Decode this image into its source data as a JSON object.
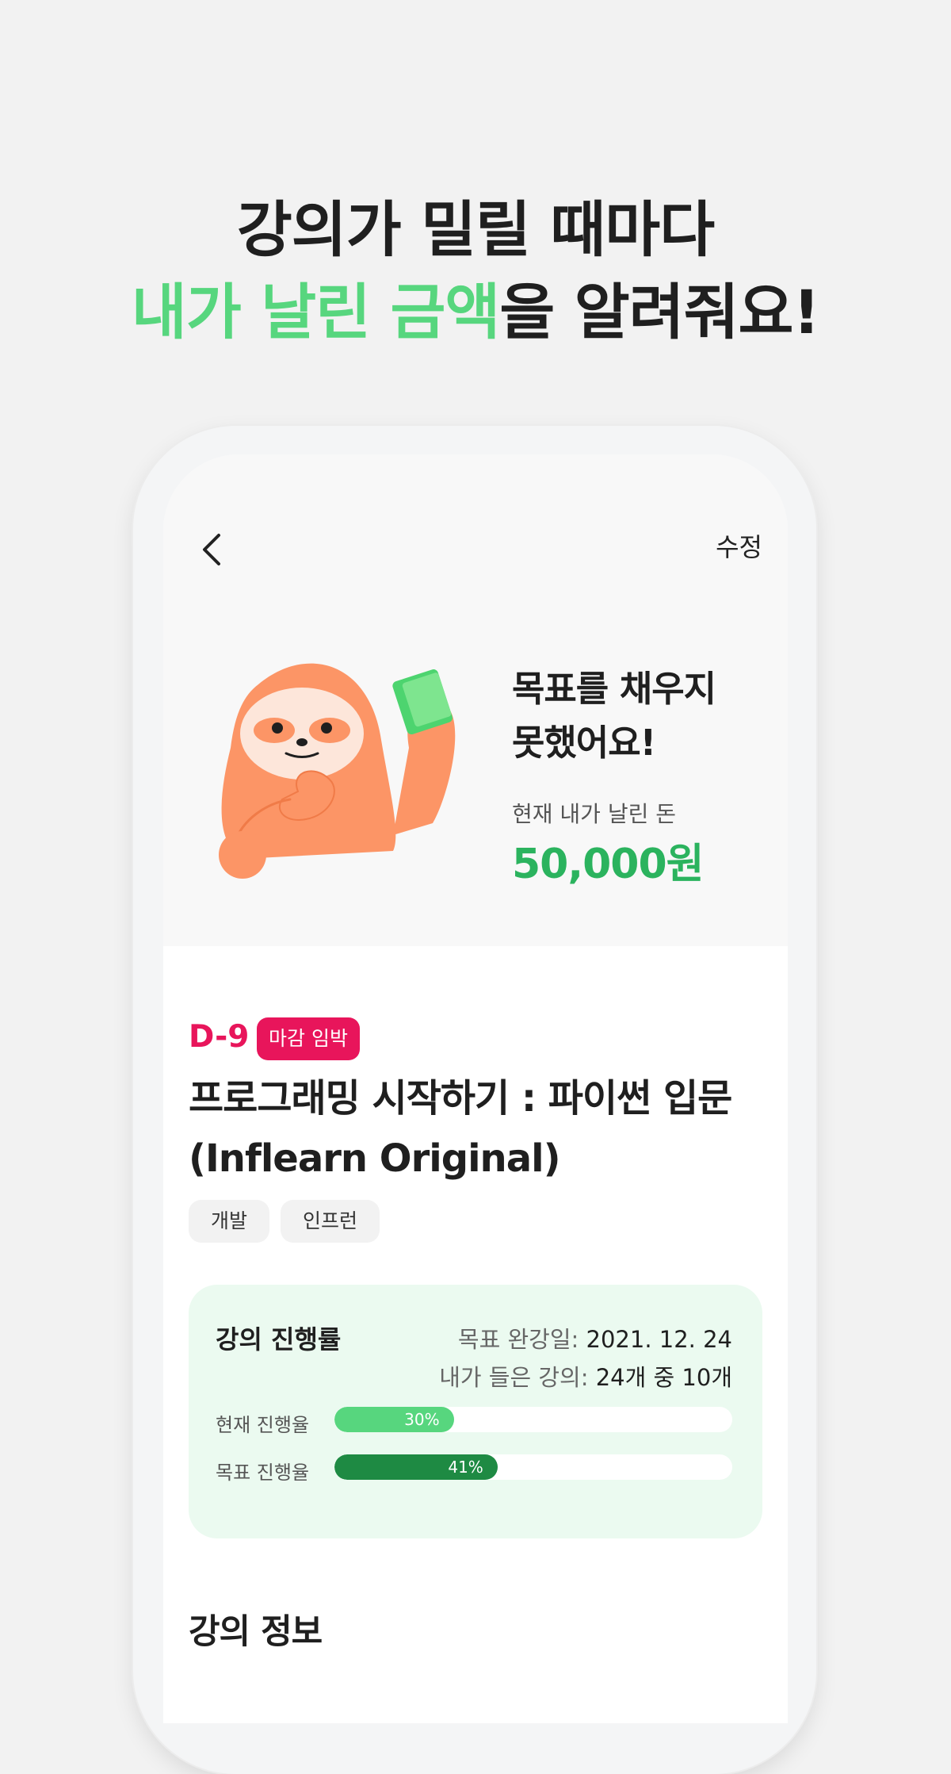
{
  "headline": {
    "line1": "강의가 밀릴 때마다",
    "line2_accent": "내가 날린 금액",
    "line2_rest": "을 알려줘요!"
  },
  "colors": {
    "accent_green": "#57d67e",
    "amount_green": "#2bb35e",
    "deadline_red": "#e8155b",
    "dark_green": "#1e8a43"
  },
  "nav": {
    "back_icon": "chevron-left-icon",
    "edit_label": "수정"
  },
  "hero": {
    "illustration": "sloth-holding-money",
    "title_line1": "목표를 채우지",
    "title_line2": "못했어요!",
    "subtitle": "현재 내가 날린 돈",
    "amount": "50,000원"
  },
  "course": {
    "dday": "D-9",
    "badge": "마감 임박",
    "title_line1": "프로그래밍 시작하기 : 파이썬 입문",
    "title_line2": "(Inflearn Original)",
    "tags": [
      "개발",
      "인프런"
    ]
  },
  "progress": {
    "title": "강의 진행률",
    "target_date_label": "목표 완강일:",
    "target_date_value": "2021. 12. 24",
    "lectures_label": "내가 들은 강의:",
    "lectures_value": "24개 중 10개",
    "rows": [
      {
        "label": "현재 진행율",
        "percent": 30,
        "percent_text": "30%",
        "color": "#57d67e"
      },
      {
        "label": "목표 진행율",
        "percent": 41,
        "percent_text": "41%",
        "color": "#1e8a43"
      }
    ]
  },
  "info": {
    "title": "강의 정보"
  }
}
